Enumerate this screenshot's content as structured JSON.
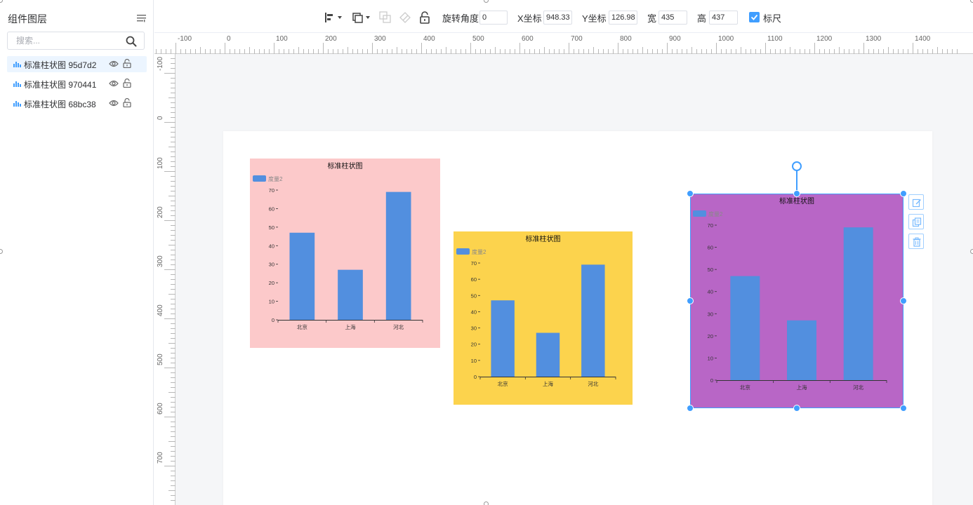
{
  "left_panel": {
    "title": "组件图层",
    "search_placeholder": "搜索...",
    "layers": [
      {
        "label": "标准柱状图 95d7d2",
        "active": true
      },
      {
        "label": "标准柱状图 970441",
        "active": false
      },
      {
        "label": "标准柱状图 68bc38",
        "active": false
      }
    ]
  },
  "toolbar": {
    "rotation_label": "旋转角度",
    "rotation_value": "0",
    "x_label": "X坐标",
    "x_value": "948.33",
    "y_label": "Y坐标",
    "y_value": "126.98",
    "width_label": "宽",
    "width_value": "435",
    "height_label": "高",
    "height_value": "437",
    "ruler_label": "标尺",
    "ruler_checked": true
  },
  "rulers": {
    "horizontal_labels": [
      "-100",
      "0",
      "100",
      "200",
      "300",
      "400",
      "500",
      "600",
      "700",
      "800",
      "900",
      "1000",
      "1100",
      "1200",
      "1300",
      "1400"
    ],
    "vertical_labels": [
      "-100",
      "0",
      "100",
      "200",
      "300",
      "400",
      "500",
      "600",
      "700"
    ]
  },
  "colors": {
    "accent": "#409eff",
    "bar": "#528fdf",
    "chart1_bg": "#fcc9ca",
    "chart2_bg": "#fcd34d",
    "chart3_bg": "#b866c6"
  },
  "chart_data": [
    {
      "type": "bar",
      "title": "标准柱状图",
      "legend": [
        "度量2"
      ],
      "categories": [
        "北京",
        "上海",
        "河北"
      ],
      "series": [
        {
          "name": "度量2",
          "values": [
            47,
            27,
            69
          ]
        }
      ],
      "ylim": [
        0,
        70
      ],
      "yticks": [
        "0",
        "10",
        "20",
        "30",
        "40",
        "50",
        "60",
        "70"
      ],
      "background": "#fcc9ca"
    },
    {
      "type": "bar",
      "title": "标准柱状图",
      "legend": [
        "度量2"
      ],
      "categories": [
        "北京",
        "上海",
        "河北"
      ],
      "series": [
        {
          "name": "度量2",
          "values": [
            47,
            27,
            69
          ]
        }
      ],
      "ylim": [
        0,
        70
      ],
      "yticks": [
        "0",
        "10",
        "20",
        "30",
        "40",
        "50",
        "60",
        "70"
      ],
      "background": "#fcd34d"
    },
    {
      "type": "bar",
      "title": "标准柱状图",
      "legend": [
        "度量2"
      ],
      "categories": [
        "北京",
        "上海",
        "河北"
      ],
      "series": [
        {
          "name": "度量2",
          "values": [
            47,
            27,
            69
          ]
        }
      ],
      "ylim": [
        0,
        70
      ],
      "yticks": [
        "0",
        "10",
        "20",
        "30",
        "40",
        "50",
        "60",
        "70"
      ],
      "background": "#b866c6"
    }
  ]
}
